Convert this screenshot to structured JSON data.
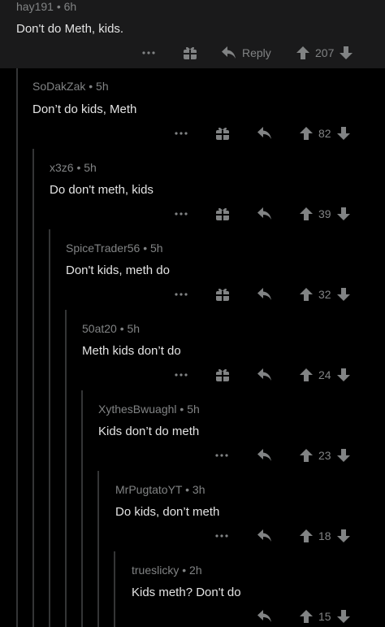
{
  "comments": [
    {
      "user": "hay191",
      "age": "6h",
      "text": "Don't do Meth, kids.",
      "score": "207",
      "reply_label": "Reply"
    },
    {
      "user": "SoDakZak",
      "age": "5h",
      "text": "Don’t do kids, Meth",
      "score": "82"
    },
    {
      "user": "x3z6",
      "age": "5h",
      "text": "Do don't meth, kids",
      "score": "39"
    },
    {
      "user": "SpiceTrader56",
      "age": "5h",
      "text": "Don't kids, meth do",
      "score": "32"
    },
    {
      "user": "50at20",
      "age": "5h",
      "text": "Meth kids don’t do",
      "score": "24"
    },
    {
      "user": "XythesBwuaghl",
      "age": "5h",
      "text": "Kids don’t do meth",
      "score": "23"
    },
    {
      "user": "MrPugtatoYT",
      "age": "3h",
      "text": "Do kids, don’t meth",
      "score": "18"
    },
    {
      "user": "trueslicky",
      "age": "2h",
      "text": "Kids meth? Don't do",
      "score": "15"
    }
  ],
  "meta_separator": "•",
  "icons": {
    "more": "more-options-icon",
    "award": "gift-award-icon",
    "reply": "reply-arrow-icon",
    "upvote": "upvote-arrow-icon",
    "downvote": "downvote-arrow-icon"
  },
  "colors": {
    "background": "#000000",
    "top_comment_bg": "#1a1a1b",
    "muted": "#818384",
    "text": "#e3e3e3",
    "thread_line": "#343536"
  }
}
